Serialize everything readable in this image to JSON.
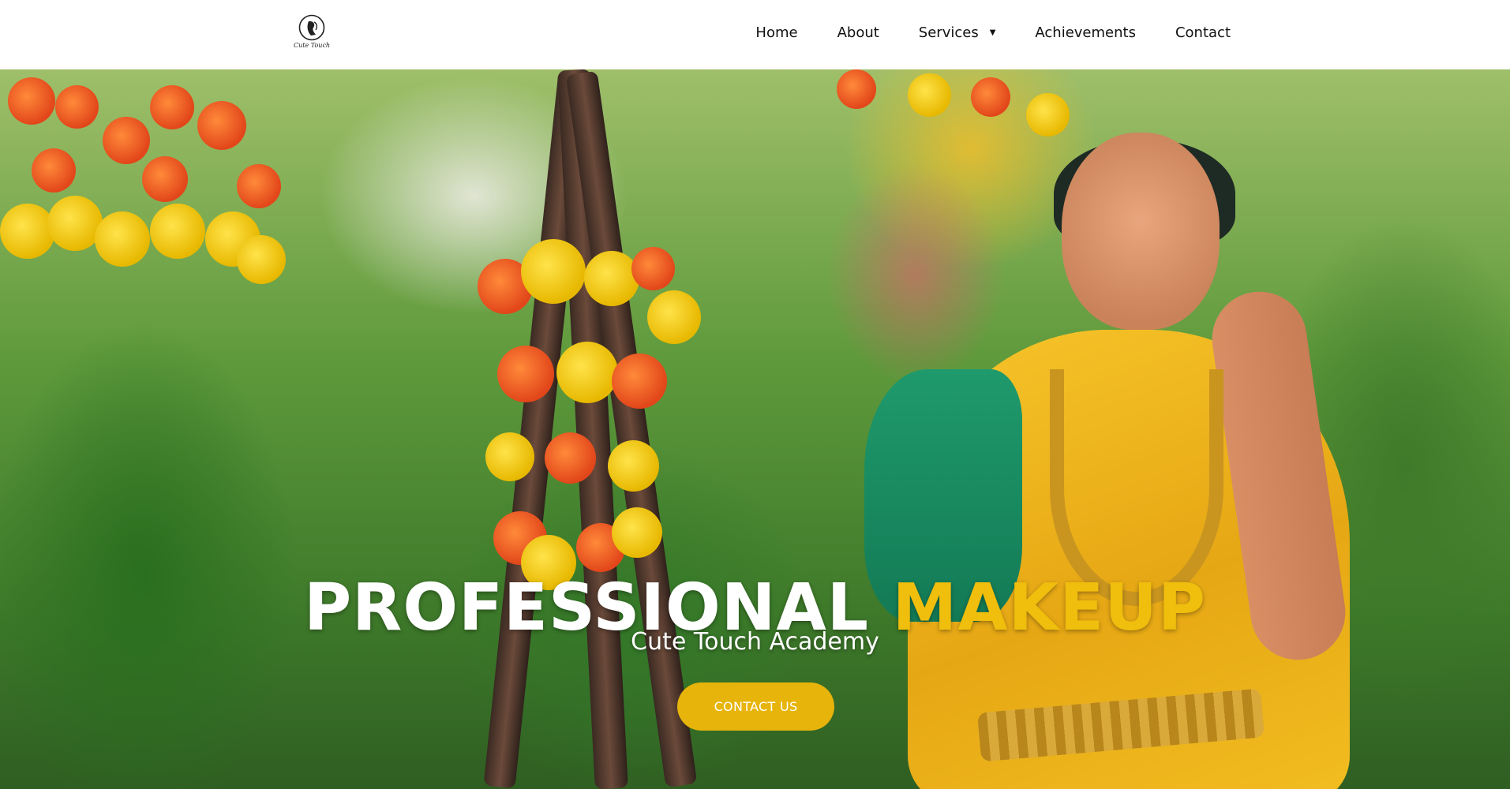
{
  "brand": {
    "logo_text": "Cute Touch",
    "logo_icon": "face-silhouette-icon"
  },
  "nav": {
    "items": [
      {
        "label": "Home"
      },
      {
        "label": "About"
      },
      {
        "label": "Services",
        "has_dropdown": true,
        "dropdown_icon": "caret-down-icon"
      },
      {
        "label": "Achievements"
      },
      {
        "label": "Contact"
      }
    ]
  },
  "hero": {
    "title_part1": "PROFESSIONAL",
    "title_part2": "MAKEUP",
    "subtitle": "Cute Touch Academy",
    "cta_label": "CONTACT US",
    "background_image": "bride-in-yellow-saree-with-marigold-decor"
  },
  "colors": {
    "accent": "#e7b40b",
    "title_highlight": "#f0be0c",
    "header_bg": "#ffffff",
    "nav_text": "#111111"
  }
}
